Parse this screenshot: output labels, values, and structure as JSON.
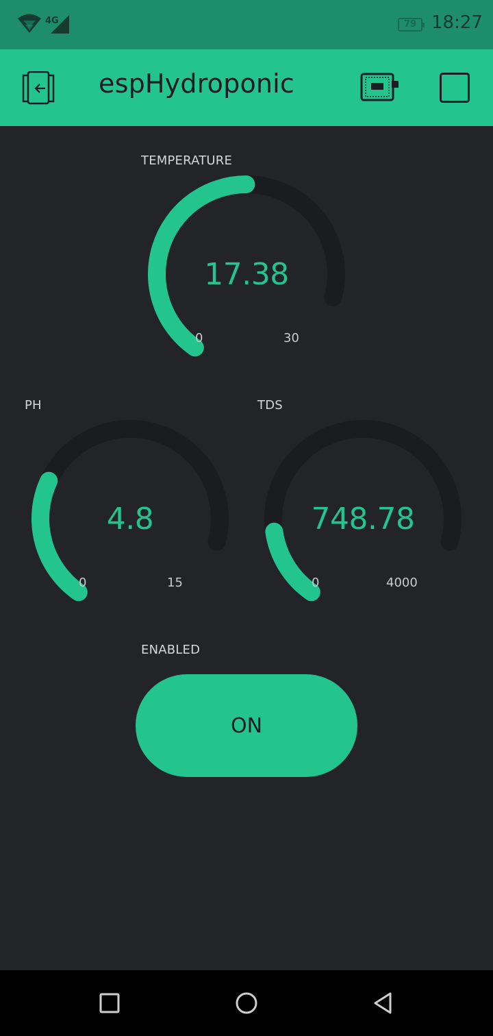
{
  "status_bar": {
    "network": "4G",
    "battery": "79",
    "time": "18:27"
  },
  "app_bar": {
    "title": "espHydroponic",
    "icons": [
      "exit-icon",
      "device-icon",
      "square-icon"
    ]
  },
  "widgets": {
    "temperature": {
      "label": "TEMPERATURE",
      "value": "17.38",
      "min": "0",
      "max": "30",
      "fraction": 0.579
    },
    "ph": {
      "label": "PH",
      "value": "4.8",
      "min": "0",
      "max": "15",
      "fraction": 0.32
    },
    "tds": {
      "label": "TDS",
      "value": "748.78",
      "min": "0",
      "max": "4000",
      "fraction": 0.187
    },
    "enabled": {
      "label": "ENABLED",
      "button_label": "ON"
    }
  },
  "colors": {
    "accent": "#23c48e",
    "status_bar": "#1d8e69",
    "background": "#222428",
    "gauge_track": "#1b1c20"
  },
  "nav_bar": {
    "icons": [
      "recent-apps-icon",
      "home-icon",
      "back-icon"
    ]
  }
}
